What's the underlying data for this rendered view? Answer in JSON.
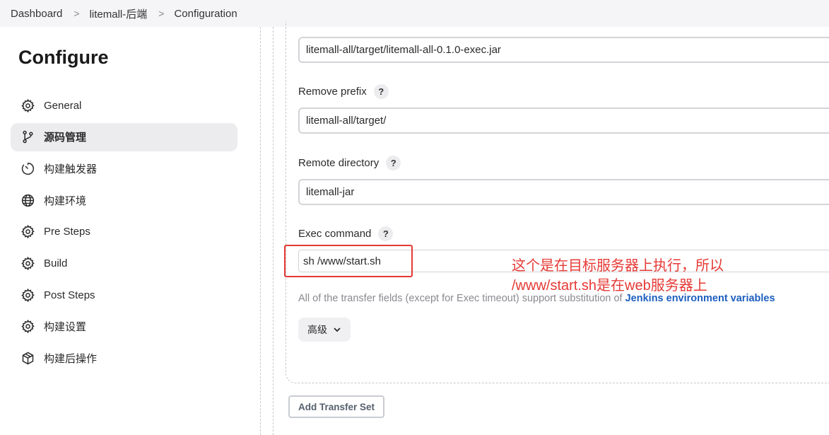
{
  "breadcrumb": {
    "items": [
      "Dashboard",
      "litemall-后端",
      "Configuration"
    ],
    "separator": ">"
  },
  "sidebar": {
    "title": "Configure",
    "items": [
      {
        "label": "General",
        "icon": "gear-icon",
        "active": false
      },
      {
        "label": "源码管理",
        "icon": "git-branch-icon",
        "active": true
      },
      {
        "label": "构建触发器",
        "icon": "timer-icon",
        "active": false
      },
      {
        "label": "构建环境",
        "icon": "globe-icon",
        "active": false
      },
      {
        "label": "Pre Steps",
        "icon": "gear-icon",
        "active": false
      },
      {
        "label": "Build",
        "icon": "gear-icon",
        "active": false
      },
      {
        "label": "Post Steps",
        "icon": "gear-icon",
        "active": false
      },
      {
        "label": "构建设置",
        "icon": "gear-icon",
        "active": false
      },
      {
        "label": "构建后操作",
        "icon": "package-icon",
        "active": false
      }
    ]
  },
  "form": {
    "source_files_value": "litemall-all/target/litemall-all-0.1.0-exec.jar",
    "remove_prefix_label": "Remove prefix",
    "remove_prefix_value": "litemall-all/target/",
    "remote_directory_label": "Remote directory",
    "remote_directory_value": "litemall-jar",
    "exec_command_label": "Exec command",
    "exec_command_value": "sh /www/start.sh",
    "help_glyph": "?",
    "info_text": "All of the transfer fields (except for Exec timeout) support substitution of ",
    "info_link": "Jenkins environment variables",
    "advanced_label": "高级",
    "add_transfer_set_label": "Add Transfer Set"
  },
  "annotation": {
    "line1": "这个是在目标服务器上执行，所以",
    "line2": "/www/start.sh是在web服务器上",
    "color": "#e53935"
  }
}
